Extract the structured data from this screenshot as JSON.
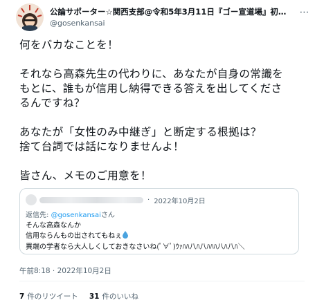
{
  "author": {
    "display_name": "公論サポーター☆関西支部@令和5年3月11日『ゴー宣道場』初の…",
    "handle": "@gosenkansai"
  },
  "more_icon": "⋯",
  "tweet": {
    "line1": "何をバカなことを！",
    "line2": "それなら高森先生の代わりに、あなたが自身の常識を",
    "line3": "もとに、誰もが信用し納得できる答えを出してくださ",
    "line4": "るんですね？",
    "line5": "あなたが「女性のみ中継ぎ」と断定する根拠は？",
    "line6": "捨て台詞では話になりませんよ！",
    "line7": "皆さん、メモのご用意を！"
  },
  "quote": {
    "separator": "·",
    "date": "2022年10月2日",
    "reply_prefix": "返信先: ",
    "reply_mention": "@gosenkansai",
    "reply_suffix": "さん",
    "line1": "そんな高森なんか",
    "line2": "信用ならんもの出されてもねぇ",
    "line3": "異端の学者なら大人しくしておきなさいね(ﾟ∀ﾟ)ｳｧﾊﾊ八ﾊ八ﾊﾊﾊ八ﾊ八ﾊ＼"
  },
  "timestamp": "午前8:18 · 2022年10月2日",
  "stats": {
    "retweets_count": "7",
    "retweets_label": "件のリツイート",
    "likes_count": "31",
    "likes_label": "件のいいね"
  },
  "icons": {
    "avatar": "avatar-image",
    "water_drop": "droplet-icon",
    "more": "more-icon"
  }
}
